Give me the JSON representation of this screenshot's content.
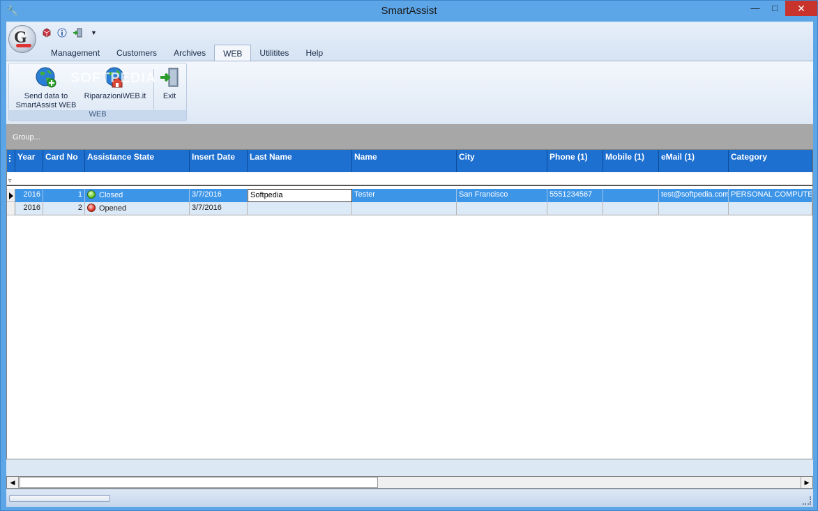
{
  "window": {
    "title": "SmartAssist"
  },
  "ribbon": {
    "tabs": [
      "Management",
      "Customers",
      "Archives",
      "WEB",
      "Utilitites",
      "Help"
    ],
    "active_tab": "WEB",
    "group_label": "WEB",
    "buttons": {
      "send_line1": "Send data to",
      "send_line2": "SmartAssist WEB",
      "riparazioni": "RiparazioniWEB.it",
      "exit": "Exit"
    },
    "watermark": "SOFTPEDIA"
  },
  "group_panel": {
    "text": "Group..."
  },
  "grid": {
    "columns": [
      "Year",
      "Card No",
      "Assistance State",
      "Insert Date",
      "Last Name",
      "Name",
      "City",
      "Phone (1)",
      "Mobile (1)",
      "eMail (1)",
      "Category"
    ],
    "rows": [
      {
        "year": "2016",
        "card_no": "1",
        "state": "Closed",
        "insert_date": "3/7/2016",
        "last_name": "Softpedia",
        "name": "Tester",
        "city": "San Francisco",
        "phone": "5551234567",
        "mobile": "",
        "email": "test@softpedia.com",
        "category": "PERSONAL COMPUTE"
      },
      {
        "year": "2016",
        "card_no": "2",
        "state": "Opened",
        "insert_date": "3/7/2016",
        "last_name": "",
        "name": "",
        "city": "",
        "phone": "",
        "mobile": "",
        "email": "",
        "category": ""
      }
    ]
  },
  "colors": {
    "header": "#1d6fd0",
    "selected_row": "#3d95e8",
    "footer": "#ffff99",
    "state_closed": "green",
    "state_opened": "red"
  }
}
